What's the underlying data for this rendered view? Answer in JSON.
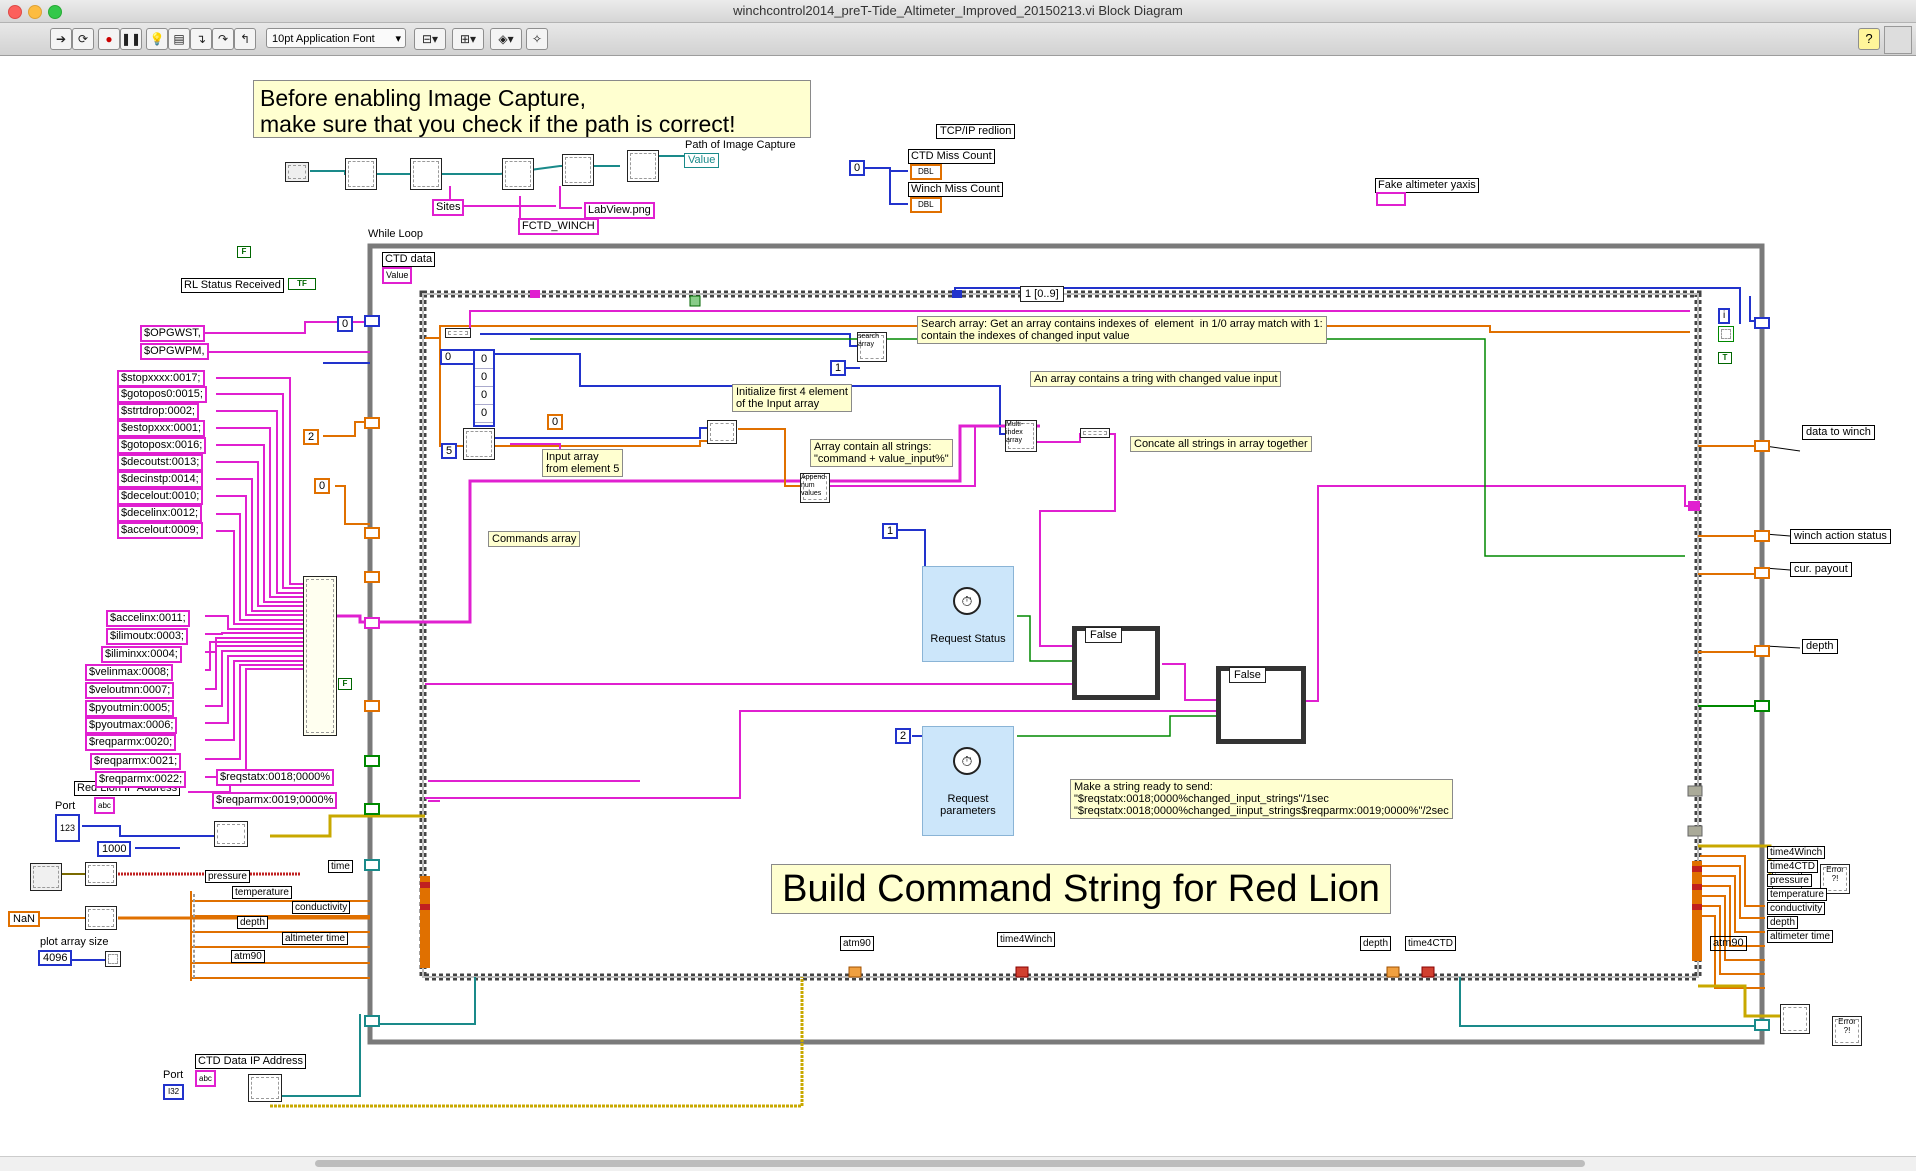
{
  "window": {
    "title": "winchcontrol2014_preT-Tide_Altimeter_Improved_20150213.vi Block Diagram",
    "font_select": "10pt Application Font",
    "help": "?"
  },
  "notes": {
    "warning": "Before enabling Image Capture,\nmake sure that you check if the path is correct!",
    "build_title": "Build Command String for Red Lion",
    "search_array": "Search array: Get an array contains indexes of  element  in 1/0 array match with 1:\ncontain the indexes of changed input value",
    "array_changed": "An array contains a tring with changed value input",
    "concat": "Concate all strings in array together",
    "init4": "Initialize first 4 element\nof the Input array",
    "input_array": "Input array\nfrom element 5",
    "array_strings": "Array contain all strings:\n\"command + value_input%\"",
    "commands_array": "Commands array",
    "make_string": "Make a string ready to send:\n\"$reqstatx:0018;0000%changed_input_strings\"/1sec\n\"$reqstatx:0018;0000%changed_iinput_strings$reqparmx:0019;0000%\"/2sec"
  },
  "labels": {
    "path_image": "Path of Image Capture",
    "value": "Value",
    "sites": "Sites",
    "fctd_winch": "FCTD_WINCH",
    "labview_png": "LabView.png",
    "tcpip_redlion": "TCP/IP redlion",
    "ctd_miss": "CTD Miss Count",
    "winch_miss": "Winch Miss Count",
    "fake_alt": "Fake altimeter yaxis",
    "while_loop": "While Loop",
    "ctd_data": "CTD data",
    "ctd_value": "Value",
    "rl_status": "RL Status Received",
    "red_lion_ip": "Red Lion IP Address",
    "port1": "Port",
    "port2": "Port",
    "ctd_data_ip": "CTD Data  IP Address",
    "plot_array_size": "plot array size",
    "nan": "NaN",
    "n1000": "1000",
    "n4096": "4096",
    "case_seq": "1 [0..9]",
    "false1": "False",
    "false2": "False",
    "request_status": "Request Status",
    "request_params": "Request\nparameters",
    "search_node": "search\narray",
    "multi_index": "Multi-\nindex\narray",
    "append": "Append\nnum\nvalues",
    "dbl1": "DBL",
    "dbl2": "DBL",
    "i32": "I32",
    "u123": "123",
    "tf": "TF",
    "f": "F",
    "t": "T",
    "i": "i",
    "n0a": "0",
    "n0b": "0",
    "n0c": "0",
    "n2": "2",
    "n5": "5",
    "n1a": "1",
    "n1b": "1",
    "n2b": "2",
    "n0d": "0",
    "array_idx": "0",
    "arr_vals": [
      "0",
      "0",
      "0",
      "0"
    ],
    "out_data_to_winch": "data to winch",
    "out_winch_action": "winch action status",
    "out_cur_payout": "cur. payout",
    "out_depth": "depth",
    "atm90_bottom": "atm90",
    "time4winch_bottom": "time4Winch",
    "depth_bottom": "depth",
    "time4ctd_bottom": "time4CTD",
    "atm90_right": "atm90",
    "err1": "Error\n?!",
    "err2": "Error\n?!"
  },
  "string_constants": [
    "$OPGWST,",
    "$OPGWPM,",
    "$stopxxxx:0017;",
    "$gotopos0:0015;",
    "$strtdrop:0002;",
    "$estopxxx:0001;",
    "$gotoposx:0016;",
    "$decoutst:0013;",
    "$decinstp:0014;",
    "$decelout:0010;",
    "$decelinx:0012;",
    "$accelout:0009;",
    "$accelinx:0011;",
    "$ilimoutx:0003;",
    "$iliminxx:0004;",
    "$velinmax:0008;",
    "$veloutmn:0007;",
    "$pyoutmin:0005;",
    "$pyoutmax:0006;",
    "$reqparmx:0020;",
    "$reqparmx:0021;",
    "$reqparmx:0022;"
  ],
  "inner_strings": [
    "$reqstatx:0018;0000%",
    "$reqparmx:0019;0000%"
  ],
  "cluster_left_labels": [
    "pressure",
    "temperature",
    "conductivity",
    "depth",
    "altimeter time",
    "atm90",
    "time"
  ],
  "cluster_right_labels": [
    "time4Winch",
    "time4CTD",
    "pressure",
    "temperature",
    "conductivity",
    "depth",
    "altimeter time"
  ],
  "colors": {
    "string_wire": "#e020d0",
    "numeric_wire": "#e07000",
    "int_wire": "#2233cc",
    "bool_wire": "#008800",
    "cluster_wire": "#7a6a00",
    "error_wire": "#c8a800",
    "teal_wire": "#1a8a8a",
    "loop_frame": "#7a7a7a",
    "note_bg": "#ffffd0"
  }
}
